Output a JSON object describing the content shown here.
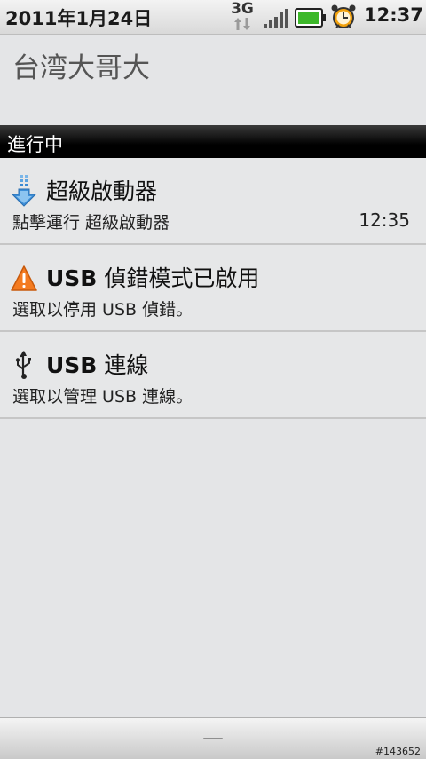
{
  "status_bar": {
    "date": "2011年1月24日",
    "network_type": "3G",
    "time": "12:37",
    "icons": [
      "network-3g-icon",
      "signal-icon",
      "battery-icon",
      "alarm-clock-icon"
    ],
    "battery_color": "#3db82a",
    "alarm_color": "#f2a10c"
  },
  "carrier": {
    "name": "台湾大哥大"
  },
  "ongoing": {
    "header": "進行中"
  },
  "notifications": [
    {
      "icon": "download-icon",
      "title": "超級啟動器",
      "text": "點擊運行 超級啟動器",
      "time": "12:35"
    },
    {
      "icon": "warning-icon",
      "title_bold": "USB",
      "title_rest": " 偵錯模式已啟用",
      "text": "選取以停用 USB 偵錯。"
    },
    {
      "icon": "usb-icon",
      "title_bold": "USB",
      "title_rest": " 連線",
      "text": "選取以管理 USB 連線。"
    }
  ],
  "watermark": "#143652"
}
